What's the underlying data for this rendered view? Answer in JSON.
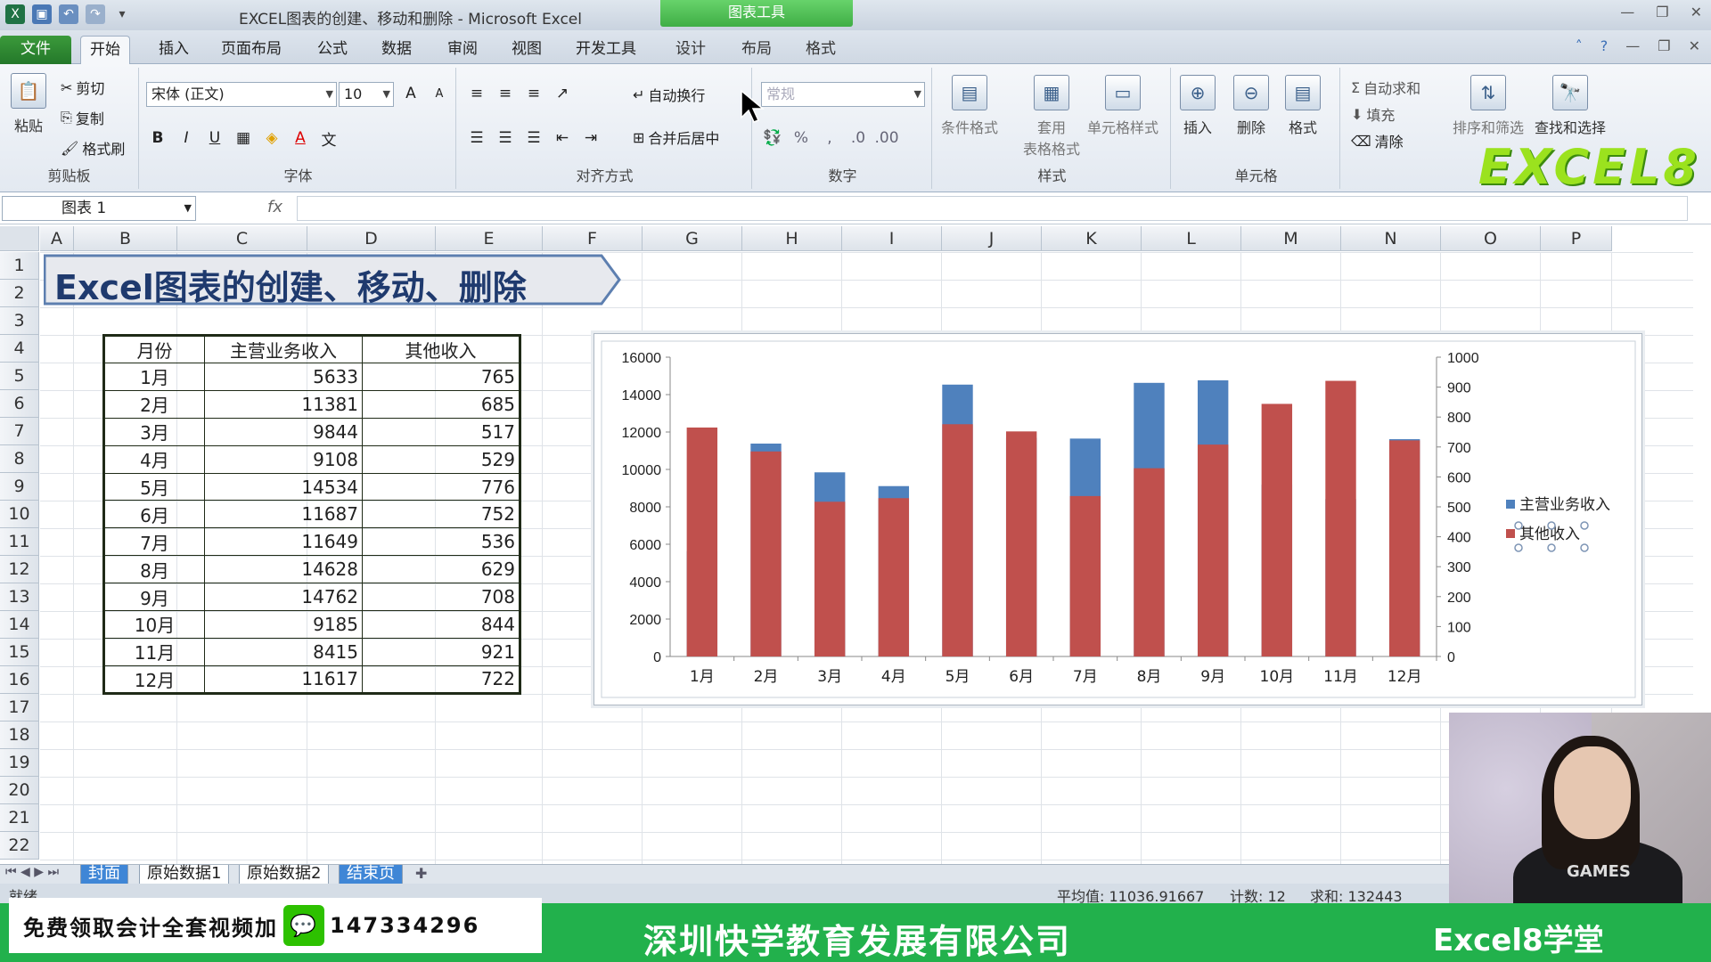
{
  "window": {
    "title": "EXCEL图表的创建、移动和删除 - Microsoft Excel",
    "context_tab_header": "图表工具"
  },
  "ribbon_tabs": [
    "文件",
    "开始",
    "插入",
    "页面布局",
    "公式",
    "数据",
    "审阅",
    "视图",
    "开发工具",
    "设计",
    "布局",
    "格式"
  ],
  "clipboard": {
    "paste": "粘贴",
    "cut": "剪切",
    "copy": "复制",
    "format_painter": "格式刷",
    "label": "剪贴板"
  },
  "font": {
    "name": "宋体 (正文)",
    "size": "10",
    "label": "字体"
  },
  "alignment": {
    "wrap": "自动换行",
    "merge": "合并后居中",
    "label": "对齐方式"
  },
  "number": {
    "format": "常规",
    "label": "数字"
  },
  "styles": {
    "conditional": "条件格式",
    "table_line1": "套用",
    "table_line2": "表格格式",
    "cell": "单元格样式",
    "label": "样式"
  },
  "cells": {
    "insert": "插入",
    "delete": "删除",
    "format": "格式",
    "label": "单元格"
  },
  "editing": {
    "autosum": "自动求和",
    "fill": "填充",
    "clear": "清除",
    "sort": "排序和筛选",
    "find": "查找和选择"
  },
  "brand_logo": "EXCEL8",
  "formula_bar": {
    "name_box": "图表 1",
    "fx": "fx",
    "content": ""
  },
  "columns": [
    "A",
    "B",
    "C",
    "D",
    "E",
    "F",
    "G",
    "H",
    "I",
    "J",
    "K",
    "L",
    "M",
    "N",
    "O",
    "P"
  ],
  "rows": [
    "1",
    "2",
    "3",
    "4",
    "5",
    "6",
    "7",
    "8",
    "9",
    "10",
    "11",
    "12",
    "13",
    "14",
    "15",
    "16",
    "17",
    "18",
    "19",
    "20",
    "21",
    "22"
  ],
  "banner_title": "Excel图表的创建、移动、删除",
  "table": {
    "headers": [
      "月份",
      "主营业务收入",
      "其他收入"
    ],
    "rows": [
      [
        "1月",
        "5633",
        "765"
      ],
      [
        "2月",
        "11381",
        "685"
      ],
      [
        "3月",
        "9844",
        "517"
      ],
      [
        "4月",
        "9108",
        "529"
      ],
      [
        "5月",
        "14534",
        "776"
      ],
      [
        "6月",
        "11687",
        "752"
      ],
      [
        "7月",
        "11649",
        "536"
      ],
      [
        "8月",
        "14628",
        "629"
      ],
      [
        "9月",
        "14762",
        "708"
      ],
      [
        "10月",
        "9185",
        "844"
      ],
      [
        "11月",
        "8415",
        "921"
      ],
      [
        "12月",
        "11617",
        "722"
      ]
    ]
  },
  "chart_data": {
    "type": "bar",
    "categories": [
      "1月",
      "2月",
      "3月",
      "4月",
      "5月",
      "6月",
      "7月",
      "8月",
      "9月",
      "10月",
      "11月",
      "12月"
    ],
    "series": [
      {
        "name": "主营业务收入",
        "axis": "left",
        "color": "#4f81bd",
        "values": [
          5633,
          11381,
          9844,
          9108,
          14534,
          11687,
          11649,
          14628,
          14762,
          9185,
          8415,
          11617
        ]
      },
      {
        "name": "其他收入",
        "axis": "right",
        "color": "#c0504d",
        "values": [
          765,
          685,
          517,
          529,
          776,
          752,
          536,
          629,
          708,
          844,
          921,
          722
        ]
      }
    ],
    "left_axis": {
      "min": 0,
      "max": 16000,
      "ticks": [
        "0",
        "2000",
        "4000",
        "6000",
        "8000",
        "10000",
        "12000",
        "14000",
        "16000"
      ]
    },
    "right_axis": {
      "min": 0,
      "max": 1000,
      "ticks": [
        "0",
        "100",
        "200",
        "300",
        "400",
        "500",
        "600",
        "700",
        "800",
        "900",
        "1000"
      ]
    },
    "legend_position": "right",
    "grid": false
  },
  "sheet_tabs": [
    "封面",
    "原始数据1",
    "原始数据2",
    "结束页"
  ],
  "status": {
    "ready": "就绪",
    "average": "平均值: 11036.91667",
    "count": "计数: 12",
    "sum": "求和: 132443"
  },
  "promo": {
    "text": "免费领取会计全套视频加",
    "phone": "147334296"
  },
  "company": "深圳快学教育发展有限公司",
  "brand_footer": "Excel8学堂",
  "webcam_shirt": "GAMES"
}
